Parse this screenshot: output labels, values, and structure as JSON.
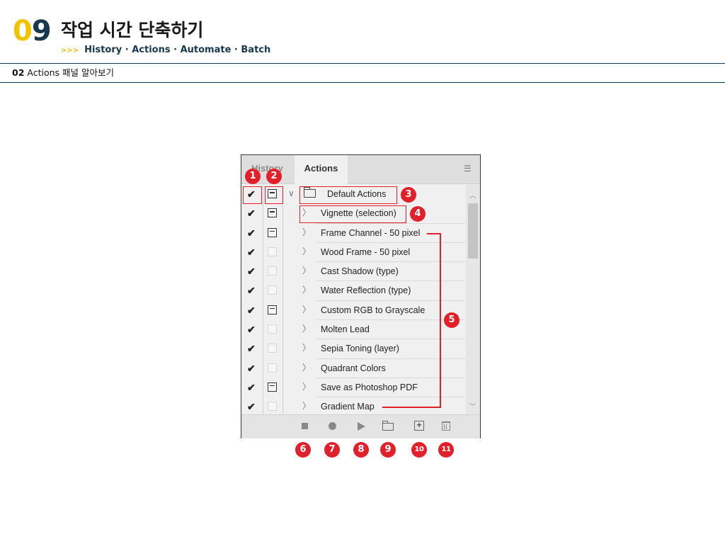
{
  "header": {
    "chapter_digit_0": "0",
    "chapter_digit_1": "9",
    "title": "작업 시간 단축하기",
    "sub_arrows": ">>>",
    "subtitle": "History · Actions · Automate · Batch"
  },
  "section": {
    "number": "02",
    "title": "Actions 패널 알아보기"
  },
  "panel": {
    "tabs": [
      "History",
      "Actions"
    ],
    "menu_icon": "panel-menu-icon",
    "group": {
      "label": "Default Actions",
      "checked": "✔",
      "dialog": true,
      "twirl": "∨"
    },
    "actions": [
      {
        "label": "Vignette (selection)",
        "checked": "✔",
        "dialog": true,
        "twirl": "〉"
      },
      {
        "label": "Frame Channel - 50 pixel",
        "checked": "✔",
        "dialog": true,
        "twirl": "〉"
      },
      {
        "label": "Wood Frame - 50 pixel",
        "checked": "✔",
        "dialog": false,
        "twirl": "〉"
      },
      {
        "label": "Cast Shadow (type)",
        "checked": "✔",
        "dialog": false,
        "twirl": "〉"
      },
      {
        "label": "Water Reflection (type)",
        "checked": "✔",
        "dialog": false,
        "twirl": "〉"
      },
      {
        "label": "Custom RGB to Grayscale",
        "checked": "✔",
        "dialog": true,
        "twirl": "〉"
      },
      {
        "label": "Molten Lead",
        "checked": "✔",
        "dialog": false,
        "twirl": "〉"
      },
      {
        "label": "Sepia Toning (layer)",
        "checked": "✔",
        "dialog": false,
        "twirl": "〉"
      },
      {
        "label": "Quadrant Colors",
        "checked": "✔",
        "dialog": false,
        "twirl": "〉"
      },
      {
        "label": "Save as Photoshop PDF",
        "checked": "✔",
        "dialog": true,
        "twirl": "〉"
      },
      {
        "label": "Gradient Map",
        "checked": "✔",
        "dialog": false,
        "twirl": "〉"
      }
    ],
    "bottom_buttons": [
      "stop-icon",
      "record-icon",
      "play-icon",
      "new-set-icon",
      "new-action-icon",
      "trash-icon"
    ],
    "new_action_glyph": "+"
  },
  "annotations": {
    "badges": [
      "1",
      "2",
      "3",
      "4",
      "5",
      "6",
      "7",
      "8",
      "9",
      "10",
      "11"
    ],
    "color": "#e2202a"
  },
  "colors": {
    "accent_yellow": "#f2c300",
    "navy": "#17384f",
    "annotation_red": "#e2202a"
  }
}
